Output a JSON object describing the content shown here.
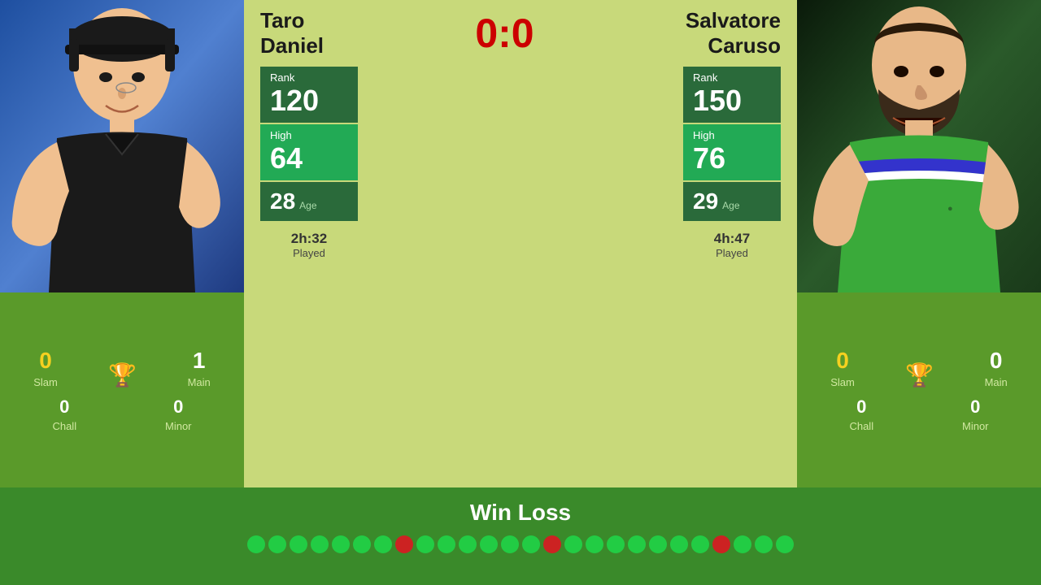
{
  "players": {
    "left": {
      "first_name": "Taro",
      "last_name": "Daniel",
      "rank_label": "Rank",
      "rank_value": "120",
      "high_label": "High",
      "high_value": "64",
      "age_value": "28",
      "age_label": "Age",
      "time_value": "2h:32",
      "time_label": "Played",
      "slam_label": "Slam",
      "slam_value": "0",
      "main_label": "Main",
      "main_value": "1",
      "chall_label": "Chall",
      "chall_value": "0",
      "minor_label": "Minor",
      "minor_value": "0"
    },
    "right": {
      "first_name": "Salvatore",
      "last_name": "Caruso",
      "rank_label": "Rank",
      "rank_value": "150",
      "high_label": "High",
      "high_value": "76",
      "age_value": "29",
      "age_label": "Age",
      "time_value": "4h:47",
      "time_label": "Played",
      "slam_label": "Slam",
      "slam_value": "0",
      "main_label": "Main",
      "main_value": "0",
      "chall_label": "Chall",
      "chall_value": "0",
      "minor_label": "Minor",
      "minor_value": "0"
    }
  },
  "score": {
    "display": "0:0"
  },
  "bottom": {
    "title": "Win Loss",
    "dots": [
      "green",
      "green",
      "green",
      "green",
      "green",
      "green",
      "green",
      "red",
      "green",
      "green",
      "green",
      "green",
      "green",
      "green",
      "red",
      "green",
      "green",
      "green",
      "green",
      "green",
      "green",
      "green",
      "red",
      "green",
      "green",
      "green"
    ]
  }
}
